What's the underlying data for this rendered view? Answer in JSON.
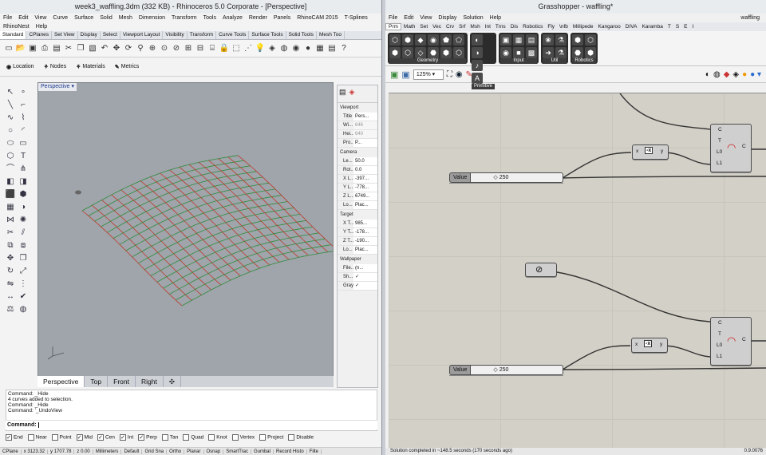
{
  "rhino": {
    "title": "week3_waffling.3dm (332 KB) - Rhinoceros  5.0 Corporate - [Perspective]",
    "menu": [
      "File",
      "Edit",
      "View",
      "Curve",
      "Surface",
      "Solid",
      "Mesh",
      "Dimension",
      "Transform",
      "Tools",
      "Analyze",
      "Render",
      "Panels",
      "RhinoCAM 2015",
      "T-Splines"
    ],
    "menu2": [
      "RhinoNest",
      "Help"
    ],
    "tabs": [
      "Standard",
      "CPlanes",
      "Set View",
      "Display",
      "Select",
      "Viewport Layout",
      "Visibility",
      "Transform",
      "Curve Tools",
      "Surface Tools",
      "Solid Tools",
      "Mesh Too"
    ],
    "panels": [
      "Location",
      "Nodes",
      "Materials",
      "Metrics"
    ],
    "viewport_label": "Perspective",
    "viewport_tabs": [
      "Perspective",
      "Top",
      "Front",
      "Right"
    ],
    "viewport_tab_add": "✣",
    "props": {
      "viewport_title": "Viewport",
      "viewport_rows": [
        [
          "Title",
          "Pers..."
        ],
        [
          "Wi...",
          "646"
        ],
        [
          "Hei...",
          "640"
        ],
        [
          "Pro...",
          "P..."
        ]
      ],
      "camera_title": "Camera",
      "camera_rows": [
        [
          "Le...",
          "50.0"
        ],
        [
          "Rot...",
          "0.0"
        ],
        [
          "X L...",
          "-397..."
        ],
        [
          "Y L...",
          "-778..."
        ],
        [
          "Z L...",
          "6749..."
        ],
        [
          "Lo...",
          "Plac..."
        ]
      ],
      "target_title": "Target",
      "target_rows": [
        [
          "X T...",
          "985..."
        ],
        [
          "Y T...",
          "-178..."
        ],
        [
          "Z T...",
          "-190..."
        ],
        [
          "Lo...",
          "Plac..."
        ]
      ],
      "wallpaper_title": "Wallpaper",
      "wallpaper_rows": [
        [
          "File...",
          "(n..."
        ],
        [
          "Sh...",
          "✓"
        ],
        [
          "Gray",
          "✓"
        ]
      ]
    },
    "command_history": [
      "Command: _Hide",
      "4 curves added to selection.",
      "Command: _Hide",
      "Command: '_UndoView"
    ],
    "command_prompt": "Command:",
    "osnaps": [
      {
        "label": "End",
        "checked": true
      },
      {
        "label": "Near",
        "checked": false
      },
      {
        "label": "Point",
        "checked": false
      },
      {
        "label": "Mid",
        "checked": true
      },
      {
        "label": "Cen",
        "checked": true
      },
      {
        "label": "Int",
        "checked": true
      },
      {
        "label": "Perp",
        "checked": true
      },
      {
        "label": "Tan",
        "checked": false
      },
      {
        "label": "Quad",
        "checked": false
      },
      {
        "label": "Knot",
        "checked": false
      },
      {
        "label": "Vertex",
        "checked": false
      },
      {
        "label": "Project",
        "checked": false
      },
      {
        "label": "Disable",
        "checked": false
      }
    ],
    "status": [
      "CPlane",
      "x 3123.32",
      "y 1707.78",
      "z 0.00",
      "Millimeters",
      "Default",
      "Grid Sna",
      "Ortho",
      "Planar",
      "Osnap",
      "SmartTrac",
      "Gumbal",
      "Record Histo",
      "Filte"
    ]
  },
  "gh": {
    "title": "Grasshopper - waffling*",
    "title_right": "waffling",
    "menu": [
      "File",
      "Edit",
      "View",
      "Display",
      "Solution",
      "Help"
    ],
    "tabs": [
      "Prm",
      "Math",
      "Set",
      "Vec",
      "Crv",
      "Srf",
      "Msh",
      "Int",
      "Trns",
      "Dis",
      "Robotics",
      "Fly",
      "\\nfb",
      "Millipede",
      "Kangaroo",
      "DIVA",
      "Karamba",
      "T",
      "S",
      "E",
      "I"
    ],
    "groups": [
      {
        "name": "Geometry",
        "icons": [
          "⬡",
          "⬢",
          "◆",
          "◉",
          "⬟",
          "⬠",
          "⬢",
          "⬡",
          "◇",
          "⬣",
          "⬢",
          "⬡"
        ]
      },
      {
        "name": "Primitive",
        "icons": [
          "◐",
          "◑",
          "♪",
          "A"
        ]
      },
      {
        "name": "Input",
        "icons": [
          "▣",
          "▦",
          "▤",
          "◉",
          "■",
          "▩"
        ]
      },
      {
        "name": "Util",
        "icons": [
          "❀",
          "⚗",
          "➜",
          "⚗"
        ]
      },
      {
        "name": "Robotics",
        "icons": [
          "⬢",
          "⬡",
          "⬣",
          "⬢"
        ]
      }
    ],
    "zoom": "125%",
    "components": [
      {
        "name": "Value",
        "value": "◇ 250"
      },
      {
        "name": "Value",
        "value": "◇ 250"
      }
    ],
    "expr": {
      "in": "x",
      "out": "y",
      "label": "-x"
    },
    "arc": {
      "inputs": [
        "C",
        "T",
        "L0",
        "L1"
      ],
      "output": "C"
    },
    "status": "Solution completed in ~148.5 seconds (170 seconds ago)",
    "version": "0.9.0076"
  }
}
